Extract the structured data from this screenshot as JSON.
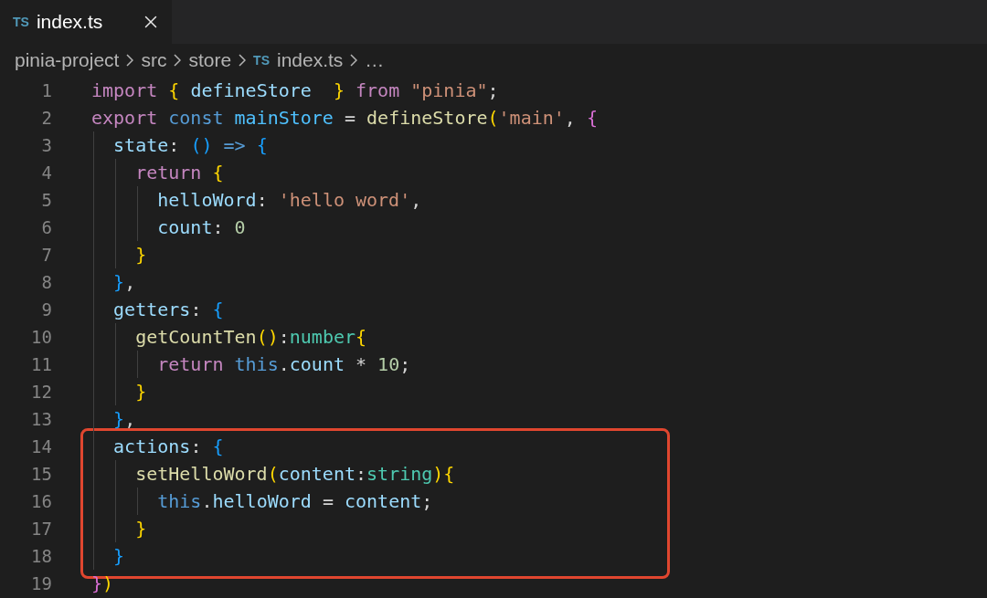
{
  "tabs": [
    {
      "icon_text": "TS",
      "label": "index.ts",
      "selected": true
    }
  ],
  "breadcrumb": [
    {
      "kind": "folder",
      "label": "pinia-project"
    },
    {
      "kind": "folder",
      "label": "src"
    },
    {
      "kind": "folder",
      "label": "store"
    },
    {
      "kind": "file",
      "icon_text": "TS",
      "label": "index.ts"
    },
    {
      "kind": "more",
      "label": "…"
    }
  ],
  "blocks": [
    {
      "highlighted": false,
      "lines": [
        {
          "number": "1",
          "tokens": [
            {
              "text": "import",
              "kind": "kw"
            },
            {
              "text": " {",
              "kind": "b1"
            },
            {
              "text": " defineStore",
              "kind": "var"
            },
            {
              "text": "  }",
              "kind": "b1"
            },
            {
              "text": " from",
              "kind": "kw"
            },
            {
              "text": " \"pinia\"",
              "kind": "str"
            },
            {
              "text": ";",
              "kind": "p"
            }
          ]
        },
        {
          "number": "2",
          "tokens": [
            {
              "text": "export",
              "kind": "kw"
            },
            {
              "text": " const",
              "kind": "st"
            },
            {
              "text": " mainStore",
              "kind": "const"
            },
            {
              "text": " =",
              "kind": "p"
            },
            {
              "text": " defineStore",
              "kind": "fn"
            },
            {
              "text": "(",
              "kind": "b1"
            },
            {
              "text": "'main'",
              "kind": "str"
            },
            {
              "text": ",",
              "kind": "p"
            },
            {
              "text": " {",
              "kind": "b2"
            }
          ]
        },
        {
          "number": "3",
          "tokens": [
            {
              "text": "  state",
              "kind": "var"
            },
            {
              "text": ":",
              "kind": "p"
            },
            {
              "text": " ()",
              "kind": "b3"
            },
            {
              "text": " =>",
              "kind": "st"
            },
            {
              "text": " {",
              "kind": "b3"
            }
          ]
        },
        {
          "number": "4",
          "tokens": [
            {
              "text": "    return",
              "kind": "kw"
            },
            {
              "text": " {",
              "kind": "b1"
            }
          ]
        },
        {
          "number": "5",
          "tokens": [
            {
              "text": "      helloWord",
              "kind": "var"
            },
            {
              "text": ":",
              "kind": "p"
            },
            {
              "text": " 'hello word'",
              "kind": "str"
            },
            {
              "text": ",",
              "kind": "p"
            }
          ]
        },
        {
          "number": "6",
          "tokens": [
            {
              "text": "      count",
              "kind": "var"
            },
            {
              "text": ":",
              "kind": "p"
            },
            {
              "text": " 0",
              "kind": "num"
            }
          ]
        },
        {
          "number": "7",
          "tokens": [
            {
              "text": "    }",
              "kind": "b1"
            }
          ]
        },
        {
          "number": "8",
          "tokens": [
            {
              "text": "  }",
              "kind": "b3"
            },
            {
              "text": ",",
              "kind": "p"
            }
          ]
        },
        {
          "number": "9",
          "tokens": [
            {
              "text": "  getters",
              "kind": "var"
            },
            {
              "text": ":",
              "kind": "p"
            },
            {
              "text": " {",
              "kind": "b3"
            }
          ]
        },
        {
          "number": "10",
          "tokens": [
            {
              "text": "    getCountTen",
              "kind": "fn"
            },
            {
              "text": "()",
              "kind": "b1"
            },
            {
              "text": ":",
              "kind": "p"
            },
            {
              "text": "number",
              "kind": "type"
            },
            {
              "text": "{",
              "kind": "b1"
            }
          ]
        },
        {
          "number": "11",
          "tokens": [
            {
              "text": "      return",
              "kind": "kw"
            },
            {
              "text": " this",
              "kind": "st"
            },
            {
              "text": ".",
              "kind": "p"
            },
            {
              "text": "count",
              "kind": "var"
            },
            {
              "text": " * ",
              "kind": "p"
            },
            {
              "text": "10",
              "kind": "num"
            },
            {
              "text": ";",
              "kind": "p"
            }
          ]
        },
        {
          "number": "12",
          "tokens": [
            {
              "text": "    }",
              "kind": "b1"
            }
          ]
        },
        {
          "number": "13",
          "tokens": [
            {
              "text": "  }",
              "kind": "b3"
            },
            {
              "text": ",",
              "kind": "p"
            }
          ]
        }
      ]
    },
    {
      "highlighted": true,
      "lines": [
        {
          "number": "14",
          "tokens": [
            {
              "text": "  actions",
              "kind": "var"
            },
            {
              "text": ":",
              "kind": "p"
            },
            {
              "text": " {",
              "kind": "b3"
            }
          ]
        },
        {
          "number": "15",
          "tokens": [
            {
              "text": "    setHelloWord",
              "kind": "fn"
            },
            {
              "text": "(",
              "kind": "b1"
            },
            {
              "text": "content",
              "kind": "var"
            },
            {
              "text": ":",
              "kind": "p"
            },
            {
              "text": "string",
              "kind": "type"
            },
            {
              "text": ")",
              "kind": "b1"
            },
            {
              "text": "{",
              "kind": "b1"
            }
          ]
        },
        {
          "number": "16",
          "tokens": [
            {
              "text": "      this",
              "kind": "st"
            },
            {
              "text": ".",
              "kind": "p"
            },
            {
              "text": "helloWord",
              "kind": "var"
            },
            {
              "text": " =",
              "kind": "p"
            },
            {
              "text": " content",
              "kind": "var"
            },
            {
              "text": ";",
              "kind": "p"
            }
          ]
        },
        {
          "number": "17",
          "tokens": [
            {
              "text": "    }",
              "kind": "b1"
            }
          ]
        },
        {
          "number": "18",
          "tokens": [
            {
              "text": "  }",
              "kind": "b3"
            }
          ]
        }
      ]
    },
    {
      "highlighted": false,
      "lines": [
        {
          "number": "19",
          "tokens": [
            {
              "text": "}",
              "kind": "b2"
            },
            {
              "text": ")",
              "kind": "b1"
            }
          ]
        }
      ]
    }
  ]
}
